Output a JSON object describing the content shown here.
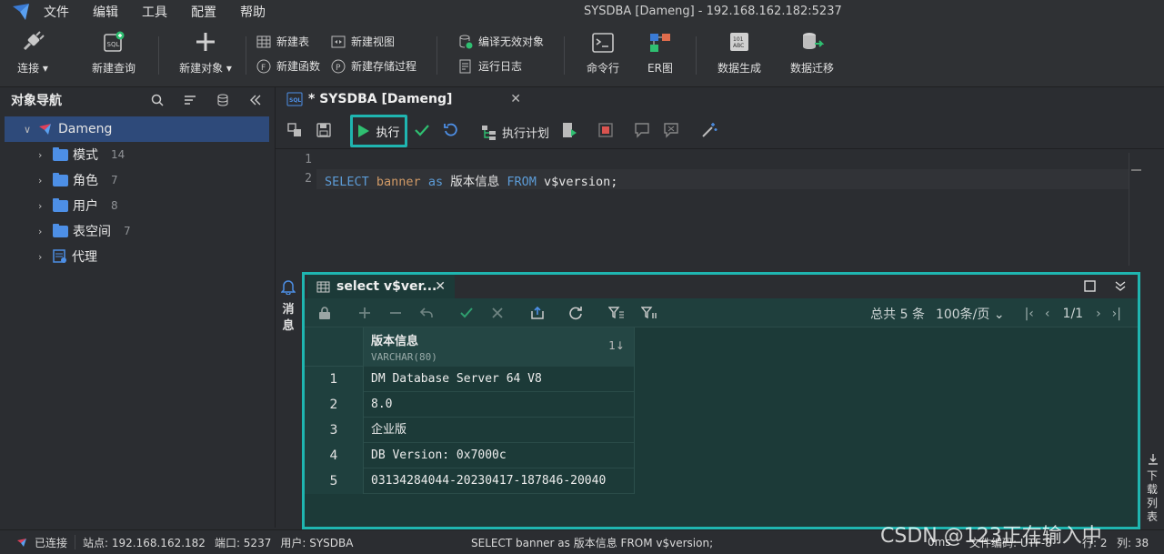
{
  "menubar": {
    "items": [
      "文件",
      "编辑",
      "工具",
      "配置",
      "帮助"
    ],
    "window_title": "SYSDBA [Dameng]  - 192.168.162.182:5237"
  },
  "toolbar": {
    "connect": "连接",
    "new_query": "新建查询",
    "new_object": "新建对象",
    "new_table": "新建表",
    "new_view": "新建视图",
    "new_function": "新建函数",
    "new_procedure": "新建存储过程",
    "compile_invalid": "编译无效对象",
    "run_log": "运行日志",
    "command_line": "命令行",
    "er_diagram": "ER图",
    "data_generation": "数据生成",
    "data_migration": "数据迁移"
  },
  "nav": {
    "title": "对象导航",
    "root": "Dameng",
    "items": [
      {
        "label": "模式",
        "count": "14"
      },
      {
        "label": "角色",
        "count": "7"
      },
      {
        "label": "用户",
        "count": "8"
      },
      {
        "label": "表空间",
        "count": "7"
      },
      {
        "label": "代理",
        "count": ""
      }
    ]
  },
  "editor": {
    "tab_title": "* SYSDBA [Dameng]",
    "run_label": "执行",
    "plan_label": "执行计划",
    "line_numbers": [
      "1",
      "2"
    ],
    "code": {
      "kw1": "SELECT",
      "ident": "banner",
      "kw2": "as",
      "alias": "版本信息",
      "kw3": "FROM",
      "rest": "v$version;"
    }
  },
  "message_tab": [
    "消",
    "息"
  ],
  "result": {
    "tab_title": "select v$ver...",
    "total": "总共 5 条",
    "page_size": "100条/页",
    "page": "1/1",
    "column": {
      "name": "版本信息",
      "type": "VARCHAR(80)"
    },
    "rows": [
      {
        "n": "1",
        "v": "DM Database Server 64 V8"
      },
      {
        "n": "2",
        "v": "8.0"
      },
      {
        "n": "3",
        "v": "企业版"
      },
      {
        "n": "4",
        "v": "DB Version: 0x7000c"
      },
      {
        "n": "5",
        "v": "03134284044-20230417-187846-20040"
      }
    ]
  },
  "download_list": [
    "下",
    "载",
    "列",
    "表"
  ],
  "status": {
    "connected": "已连接",
    "site": "站点: 192.168.162.182",
    "port": "端口: 5237",
    "user": "用户: SYSDBA",
    "sql": "SELECT banner as 版本信息 FROM v$version;",
    "time": "0ms",
    "encoding": "文件编码: UTF-8",
    "line": "行: 2",
    "col": "列: 38"
  },
  "watermark": "CSDN @123正在输入中",
  "colors": {
    "accent": "#1fb5b0",
    "run_green": "#2fbf71",
    "keyword": "#5c9bd6",
    "ident": "#d19a66"
  }
}
